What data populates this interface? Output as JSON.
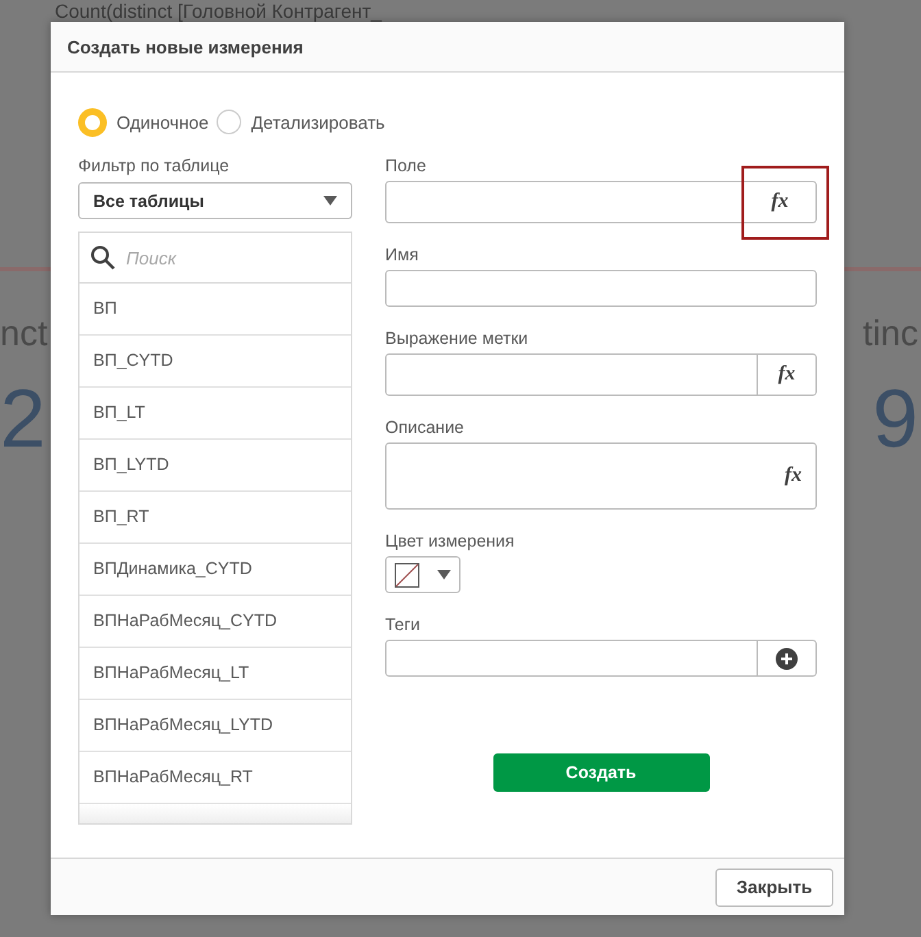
{
  "window": {
    "title": "Создать новые измерения"
  },
  "background": {
    "title": "Count(distinct [Головной Контрагент_",
    "left_fragment": "nct",
    "right_fragment": "tinc",
    "left_value": "2",
    "right_value": "9"
  },
  "mode_options": [
    {
      "label": "Одиночное",
      "selected": true
    },
    {
      "label": "Детализировать",
      "selected": false
    }
  ],
  "table_filter": {
    "label": "Фильтр по таблице",
    "value": "Все таблицы"
  },
  "field_list": {
    "search_placeholder": "Поиск",
    "items": [
      "ВП",
      "ВП_CYTD",
      "ВП_LT",
      "ВП_LYTD",
      "ВП_RT",
      "ВПДинамика_CYTD",
      "ВПНаРабМесяц_CYTD",
      "ВПНаРабМесяц_LT",
      "ВПНаРабМесяц_LYTD",
      "ВПНаРабМесяц_RT"
    ]
  },
  "form": {
    "fields": [
      {
        "kind": "expression",
        "label": "Поле",
        "button_text": "fx",
        "highlighted": true
      },
      {
        "kind": "text",
        "label": "Имя",
        "highlighted": false
      },
      {
        "kind": "expression",
        "label": "Выражение метки",
        "button_text": "fx",
        "highlighted": false
      },
      {
        "kind": "multiline",
        "label": "Описание",
        "button_text": "fx",
        "highlighted": false
      },
      {
        "kind": "color",
        "label": "Цвет измерения",
        "highlighted": false
      },
      {
        "kind": "tags",
        "label": "Теги",
        "highlighted": false
      }
    ]
  },
  "create_button": "Создать",
  "close_button": "Закрыть"
}
